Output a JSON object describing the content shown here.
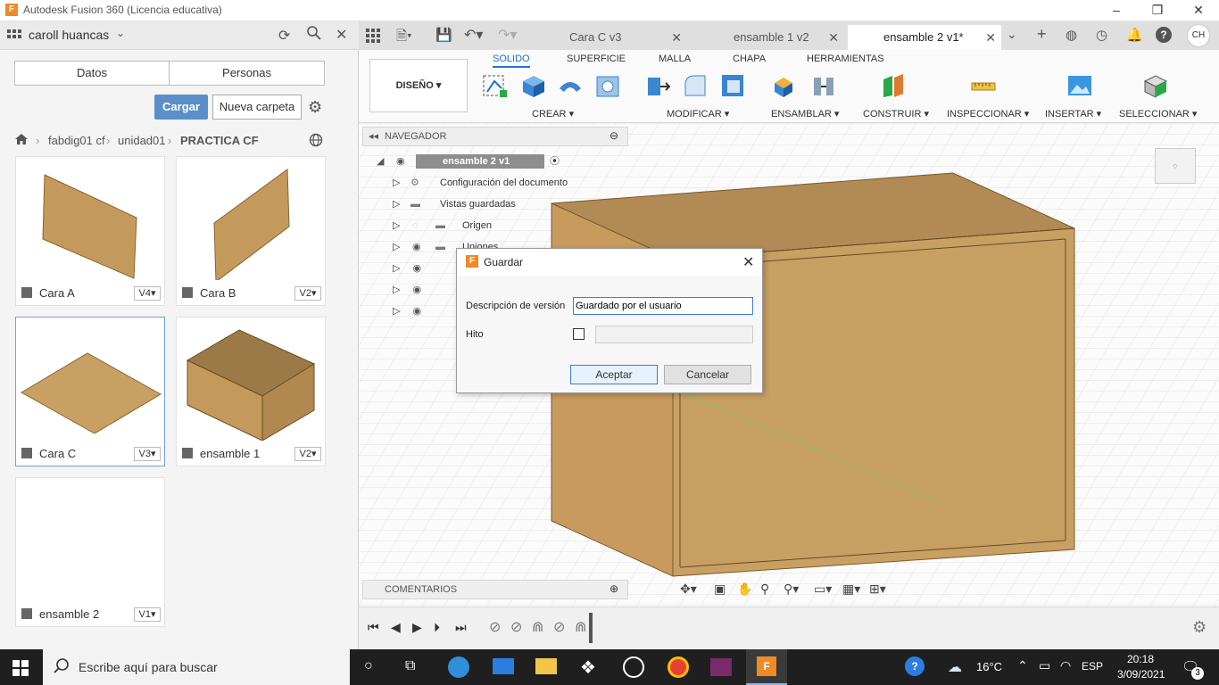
{
  "window": {
    "title": "Autodesk Fusion 360 (Licencia educativa)"
  },
  "user": {
    "name": "caroll huancas",
    "initials": "CH"
  },
  "panel_tabs": [
    "Datos",
    "Personas"
  ],
  "panel_actions": {
    "upload": "Cargar",
    "new_folder": "Nueva carpeta"
  },
  "breadcrumb": [
    "fabdig01 cf",
    "unidad01",
    "PRACTICA CF"
  ],
  "files": [
    {
      "name": "Cara A",
      "version": "V4"
    },
    {
      "name": "Cara B",
      "version": "V2"
    },
    {
      "name": "Cara C",
      "version": "V3"
    },
    {
      "name": "ensamble 1",
      "version": "V2"
    },
    {
      "name": "ensamble 2",
      "version": "V1"
    }
  ],
  "doc_tabs": [
    {
      "label": "Cara C v3"
    },
    {
      "label": "ensamble 1 v2"
    },
    {
      "label": "ensamble 2 v1*"
    }
  ],
  "toolbar": {
    "workspace": "DISEÑO",
    "tabs": [
      "SOLIDO",
      "SUPERFICIE",
      "MALLA",
      "CHAPA",
      "HERRAMIENTAS"
    ],
    "groups": [
      "CREAR",
      "MODIFICAR",
      "ENSAMBLAR",
      "CONSTRUIR",
      "INSPECCIONAR",
      "INSERTAR",
      "SELECCIONAR"
    ]
  },
  "navigator": {
    "title": "NAVEGADOR",
    "root": "ensamble 2 v1",
    "items": [
      "Configuración del documento",
      "Vistas guardadas",
      "Origen",
      "Uniones"
    ]
  },
  "comments": {
    "title": "COMENTARIOS"
  },
  "dialog": {
    "title": "Guardar",
    "desc_label": "Descripción de versión",
    "desc_value": "Guardado por el usuario",
    "milestone_label": "Hito",
    "ok": "Aceptar",
    "cancel": "Cancelar"
  },
  "taskbar": {
    "search_placeholder": "Escribe aquí para buscar",
    "weather": "16°C",
    "lang": "ESP",
    "time": "20:18",
    "date": "3/09/2021",
    "notifications": "3"
  },
  "colors": {
    "accent": "#1d73d3",
    "upload": "#5a8fc8",
    "wood": "#c8a064"
  }
}
